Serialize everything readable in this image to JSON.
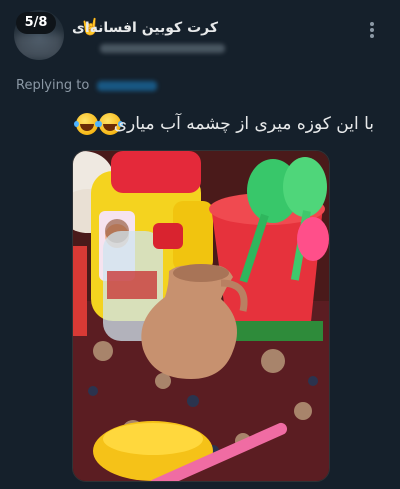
{
  "header": {
    "page_indicator": "5/8",
    "display_name": "کرت کوبین افسانه‌ای",
    "name_emoji": "🤘"
  },
  "reply": {
    "label": "Replying to"
  },
  "tweet": {
    "text": "با این کوزه میری از چشمه آب میاری",
    "emoji": "😂😂"
  },
  "colors": {
    "background": "#15202b",
    "text": "#e7e9ea",
    "muted": "#8b98a5",
    "link": "#1d9bf0"
  },
  "icons": [
    "rock-hand-icon",
    "more-icon",
    "laugh-emoji-icon"
  ]
}
